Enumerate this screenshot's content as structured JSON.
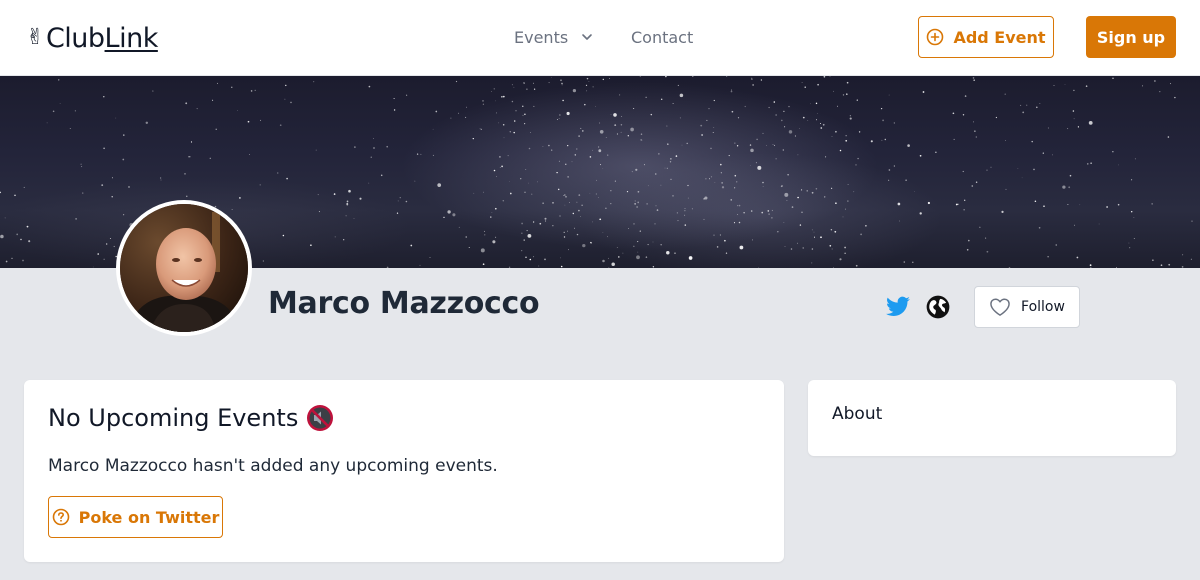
{
  "header": {
    "logo_prefix": "Club",
    "logo_suffix": "Link",
    "nav": {
      "events_label": "Events",
      "contact_label": "Contact"
    },
    "add_event_label": "Add Event",
    "signup_label": "Sign up"
  },
  "profile": {
    "name": "Marco Mazzocco",
    "follow_label": "Follow"
  },
  "events_card": {
    "title": "No Upcoming Events",
    "message": "Marco Mazzocco hasn't added any upcoming events.",
    "poke_label": "Poke on Twitter"
  },
  "about_card": {
    "title": "About"
  },
  "colors": {
    "accent": "#d97706",
    "twitter": "#1d9bf0",
    "page_bg": "#e5e7eb"
  },
  "icons": {
    "logo": "victory-hand-icon",
    "events_dropdown": "chevron-down-icon",
    "add_event": "plus-circle-icon",
    "twitter": "twitter-icon",
    "website": "globe-icon",
    "follow": "heart-icon",
    "no_events": "muted-speaker-icon",
    "poke": "question-circle-icon"
  }
}
